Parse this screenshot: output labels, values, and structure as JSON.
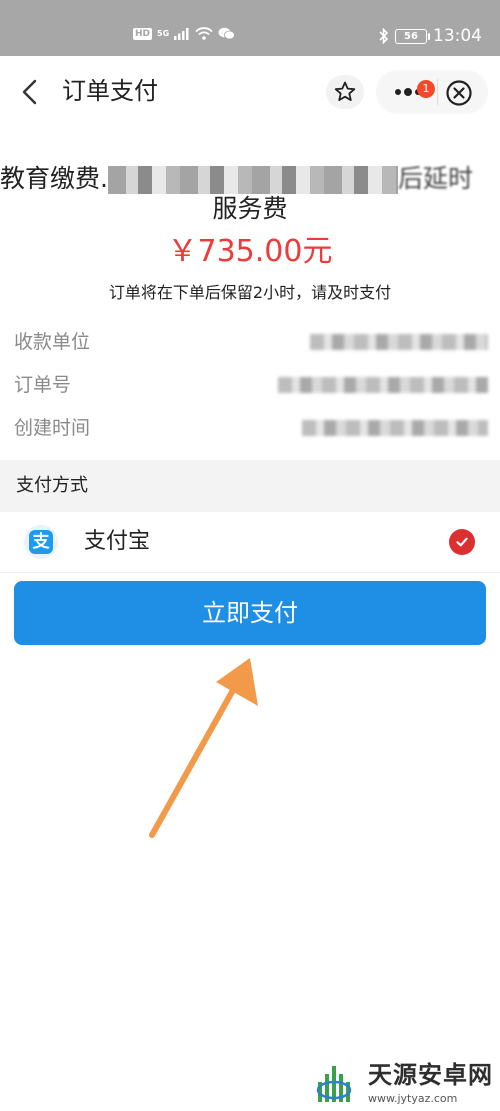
{
  "status_bar": {
    "hd": "HD",
    "network": "5G",
    "time": "13:04",
    "battery": "56"
  },
  "nav": {
    "title": "订单支付",
    "badge_count": "1"
  },
  "order": {
    "title_line1": "教育缴费.",
    "title_tail": "后延时",
    "title_line2": "服务费",
    "amount": "￥735.00元",
    "notice": "订单将在下单后保留2小时，请及时支付"
  },
  "details": [
    {
      "label": "收款单位"
    },
    {
      "label": "订单号"
    },
    {
      "label": "创建时间"
    }
  ],
  "payment": {
    "section_label": "支付方式",
    "method_label": "支付宝",
    "method_icon": "alipay-icon",
    "selected": true,
    "pay_button": "立即支付"
  },
  "colors": {
    "accent_blue": "#1f8fe6",
    "amount_red": "#ee3a3a",
    "check_red": "#dc2f2f",
    "arrow_orange": "#f39a4a"
  },
  "watermark": {
    "name": "天源安卓网",
    "url": "www.jytyaz.com"
  }
}
